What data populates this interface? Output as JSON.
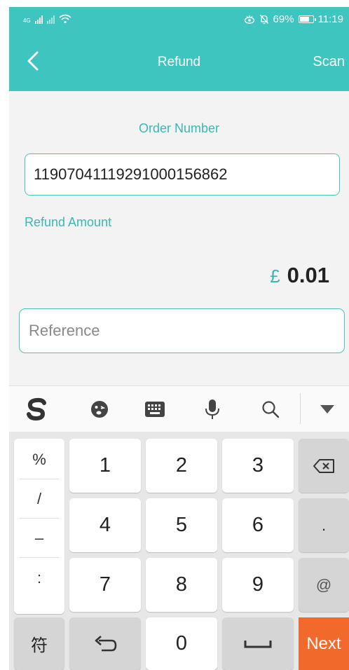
{
  "status_bar": {
    "network": "4G",
    "battery": "69%",
    "time": "11:19"
  },
  "header": {
    "title": "Refund",
    "scan_label": "Scan"
  },
  "form": {
    "order_label": "Order Number",
    "order_value": "11907041119291000156862",
    "amount_label": "Refund Amount",
    "currency": "£",
    "amount": "0.01",
    "reference_placeholder": "Reference"
  },
  "keyboard": {
    "symbols": [
      "%",
      "/",
      "–",
      ":"
    ],
    "digits": [
      "1",
      "2",
      "3",
      "4",
      "5",
      "6",
      "7",
      "8",
      "9",
      "0"
    ],
    "period": ".",
    "at": "@",
    "fu_label": "符",
    "next_label": "Next"
  },
  "colors": {
    "accent": "#3ec5bf",
    "next_key": "#f26a2b"
  }
}
